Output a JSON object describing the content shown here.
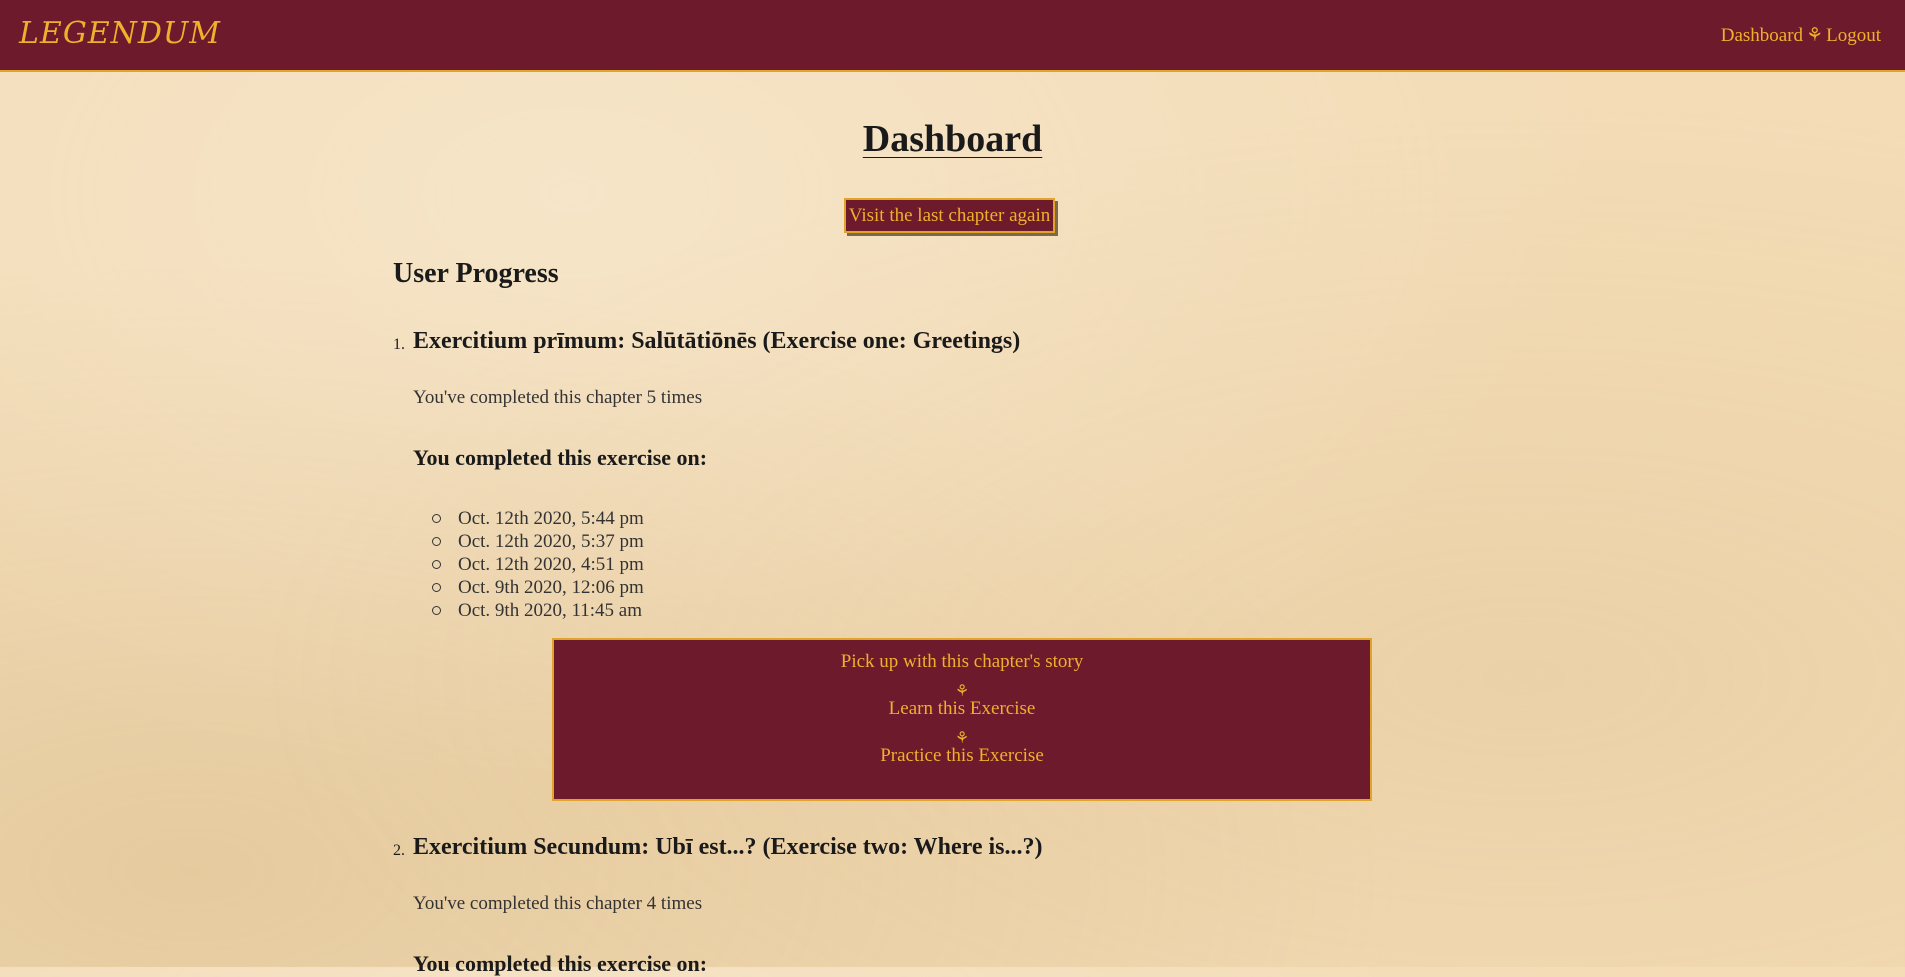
{
  "nav": {
    "brand": "LEGENDUM",
    "dashboard": "Dashboard",
    "separator": "⚘",
    "logout": "Logout"
  },
  "page": {
    "title": "Dashboard",
    "visit_last": "Visit the last chapter again",
    "section_title": "User Progress"
  },
  "exercises": [
    {
      "number": "1.",
      "title": "Exercitium prīmum: Salūtātiōnēs (Exercise one: Greetings)",
      "completed": "You've completed this chapter 5 times",
      "dates_heading": "You completed this exercise on:",
      "dates": [
        "Oct. 12th 2020, 5:44 pm",
        "Oct. 12th 2020, 5:37 pm",
        "Oct. 12th 2020, 4:51 pm",
        "Oct. 9th 2020, 12:06 pm",
        "Oct. 9th 2020, 11:45 am"
      ],
      "actions": {
        "story": "Pick up with this chapter's story",
        "learn": "Learn this Exercise",
        "practice": "Practice this Exercise",
        "divider": "⚘"
      }
    },
    {
      "number": "2.",
      "title": "Exercitium Secundum: Ubī est...? (Exercise two: Where is...?)",
      "completed": "You've completed this chapter 4 times",
      "dates_heading": "You completed this exercise on:"
    }
  ],
  "colors": {
    "navbar": "#6d1a2c",
    "accent": "#f0b02c",
    "parchment": "#f3dcb6"
  }
}
